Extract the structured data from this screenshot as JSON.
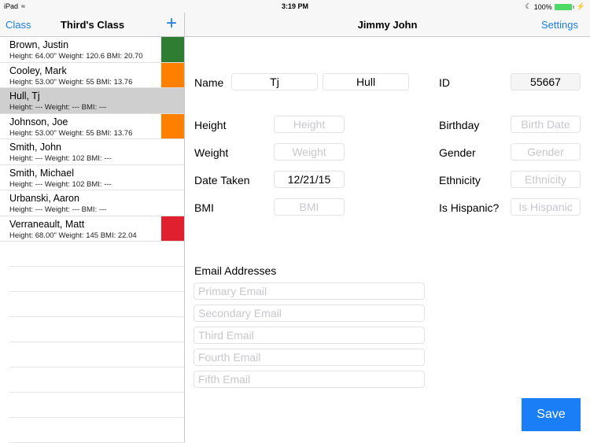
{
  "status_bar": {
    "device": "iPad",
    "time": "3:19 PM",
    "battery": "100%",
    "battery_level_percent": 100
  },
  "left_nav": {
    "back_label": "Class",
    "title": "Third's Class",
    "add_icon": "+"
  },
  "right_nav": {
    "title": "Jimmy John",
    "settings_label": "Settings"
  },
  "students": [
    {
      "name": "Brown, Justin",
      "stats": "Height: 64.00\" Weight: 120.6 BMI: 20.70",
      "color": "#2e7d32",
      "selected": false
    },
    {
      "name": "Cooley, Mark",
      "stats": "Height: 53.00\" Weight: 55 BMI: 13.76",
      "color": "#ff8000",
      "selected": false
    },
    {
      "name": "Hull, Tj",
      "stats": "Height: --- Weight: --- BMI: ---",
      "color": null,
      "selected": true
    },
    {
      "name": "Johnson, Joe",
      "stats": "Height: 53.00\" Weight: 55 BMI: 13.76",
      "color": "#ff8000",
      "selected": false
    },
    {
      "name": "Smith, John",
      "stats": "Height: --- Weight: 102 BMI: ---",
      "color": null,
      "selected": false
    },
    {
      "name": "Smith, Michael",
      "stats": "Height: --- Weight: 102 BMI: ---",
      "color": null,
      "selected": false
    },
    {
      "name": "Urbanski, Aaron",
      "stats": "Height: --- Weight: --- BMI: ---",
      "color": null,
      "selected": false
    },
    {
      "name": "Verraneault, Matt",
      "stats": "Height: 68.00\" Weight: 145 BMI: 22.04",
      "color": "#e0202e",
      "selected": false
    }
  ],
  "form": {
    "name_label": "Name",
    "first_name": "Tj",
    "last_name": "Hull",
    "id_label": "ID",
    "id_value": "55667",
    "height_label": "Height",
    "height_placeholder": "Height",
    "weight_label": "Weight",
    "weight_placeholder": "Weight",
    "date_label": "Date Taken",
    "date_value": "12/21/15",
    "bmi_label": "BMI",
    "bmi_placeholder": "BMI",
    "birthday_label": "Birthday",
    "birthday_placeholder": "Birth Date",
    "gender_label": "Gender",
    "gender_placeholder": "Gender",
    "ethnicity_label": "Ethnicity",
    "ethnicity_placeholder": "Ethnicity",
    "hispanic_label": "Is Hispanic?",
    "hispanic_placeholder": "Is Hispanic",
    "email_heading": "Email Addresses",
    "emails": [
      {
        "placeholder": "Primary Email"
      },
      {
        "placeholder": "Secondary Email"
      },
      {
        "placeholder": "Third Email"
      },
      {
        "placeholder": "Fourth Email"
      },
      {
        "placeholder": "Fifth Email"
      }
    ],
    "save_label": "Save"
  }
}
